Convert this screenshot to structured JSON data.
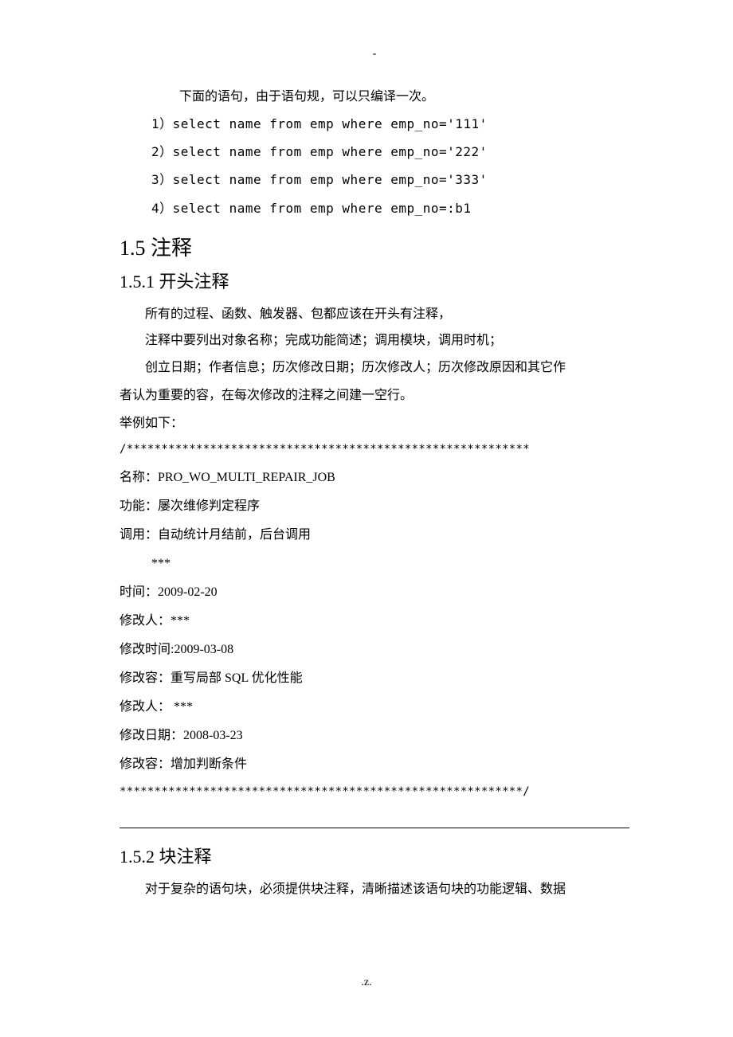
{
  "header_mark": "-",
  "intro": "下面的语句，由于语句规，可以只编译一次。",
  "code_lines": [
    "1）select name from emp where emp_no='111'",
    "2）select name from emp where emp_no='222'",
    "3）select name from emp where emp_no='333'",
    "4）select name from emp where emp_no=:b1"
  ],
  "sec15": "1.5 注释",
  "sec151": "1.5.1 开头注释",
  "p1": "所有的过程、函数、触发器、包都应该在开头有注释，",
  "p2": "注释中要列出对象名称；完成功能简述；调用模块，调用时机；",
  "p3": "创立日期；作者信息；历次修改日期；历次修改人；历次修改原因和其它作",
  "p3b": "者认为重要的容，在每次修改的注释之间建一空行。",
  "example_label": "举例如下：",
  "stars_open": "/**********************************************************",
  "c_name": "名称：PRO_WO_MULTI_REPAIR_JOB",
  "c_func": "功能：屡次维修判定程序",
  "c_call": "调用：自动统计月结前，后台调用",
  "c_triple": "***",
  "c_time": "时间：2009-02-20",
  "c_modp1": "修改人：***",
  "c_modt1": "修改时间:2009-03-08",
  "c_modc1": "修改容：重写局部 SQL 优化性能",
  "c_modp2": "修改人：  ***",
  "c_modd2": "修改日期：2008-03-23",
  "c_modc2": "修改容：增加判断条件",
  "stars_close": "**********************************************************/",
  "sec152": "1.5.2 块注释",
  "p4": "对于复杂的语句块，必须提供块注释，清晰描述该语句块的功能逻辑、数据",
  "footer_left": ".",
  "footer_right": "z."
}
